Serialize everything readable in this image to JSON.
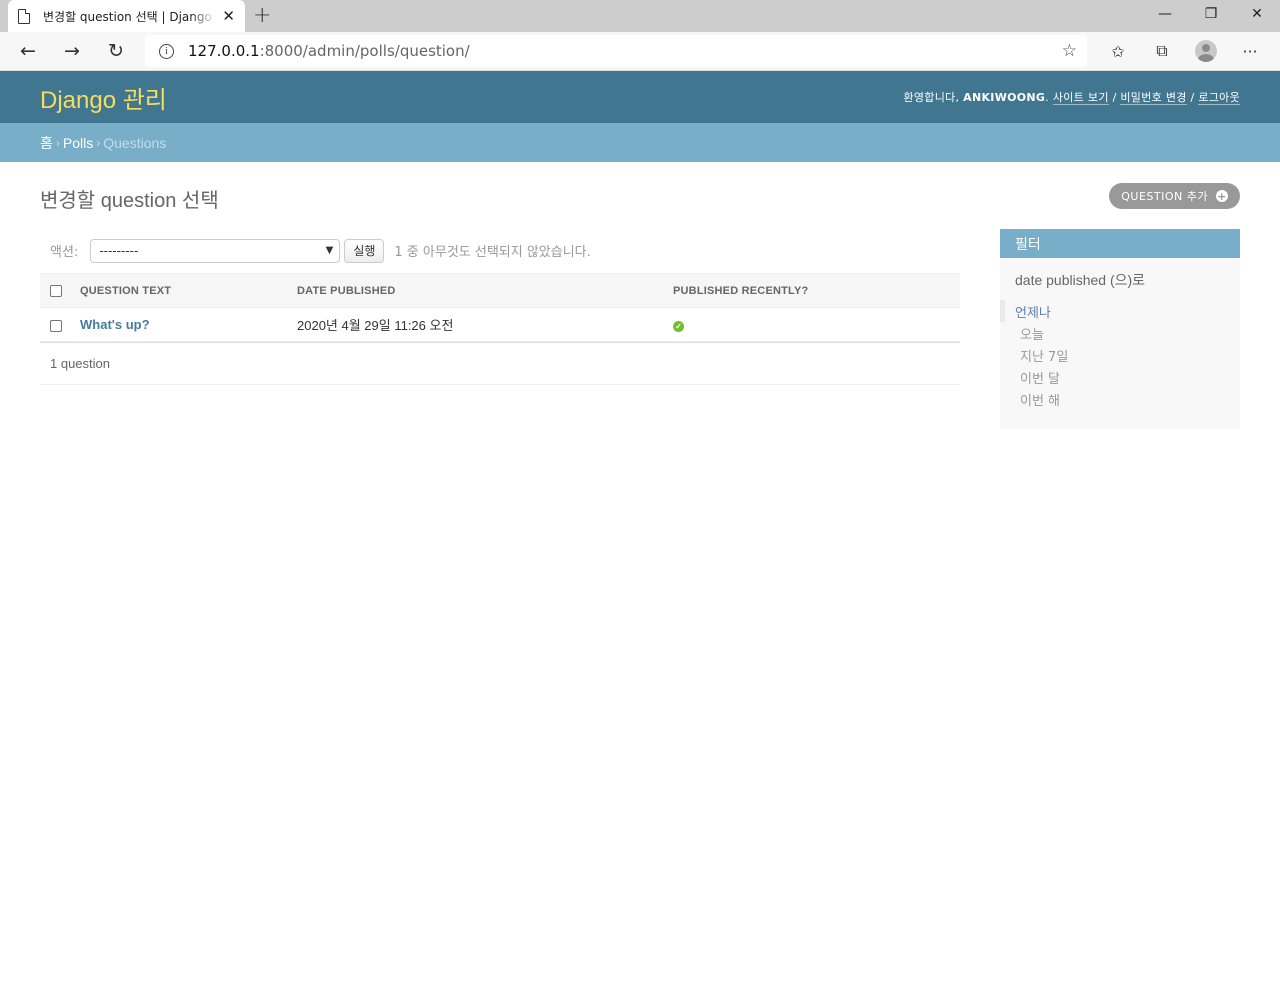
{
  "browser": {
    "tab_title": "변경할 question 선택 | Django 사이트 관리",
    "url_host": "127.0.0.1",
    "url_path": ":8000/admin/polls/question/",
    "window_controls": {
      "minimize": "—",
      "restore": "❐",
      "close": "✕"
    }
  },
  "header": {
    "branding": "Django 관리",
    "welcome": "환영합니다,",
    "username": "ANKIWOONG",
    "view_site": "사이트 보기",
    "change_password": "비밀번호 변경",
    "logout": "로그아웃",
    "separator": "/"
  },
  "breadcrumbs": {
    "home": "홈",
    "app": "Polls",
    "current": "Questions"
  },
  "page": {
    "title": "변경할 question 선택",
    "add_button": "QUESTION 추가"
  },
  "actions": {
    "label": "액션:",
    "selected": "---------",
    "run_button": "실행",
    "counter": "1 중 아무것도 선택되지 않았습니다."
  },
  "table": {
    "headers": {
      "question_text": "QUESTION TEXT",
      "date_published": "DATE PUBLISHED",
      "published_recently": "PUBLISHED RECENTLY?"
    },
    "rows": [
      {
        "question_text": "What's up?",
        "date_published": "2020년 4월 29일 11:26 오전",
        "published_recently": true
      }
    ],
    "paginator": "1 question"
  },
  "filter": {
    "title": "필터",
    "subtitle": "date published (으)로",
    "options": [
      "언제나",
      "오늘",
      "지난 7일",
      "이번 달",
      "이번 해"
    ],
    "selected_index": 0
  },
  "colors": {
    "header_bg": "#417690",
    "branding": "#f5dd5d",
    "breadcrumbs_bg": "#79aec8",
    "link": "#447e9b",
    "success": "#70bf2b"
  }
}
